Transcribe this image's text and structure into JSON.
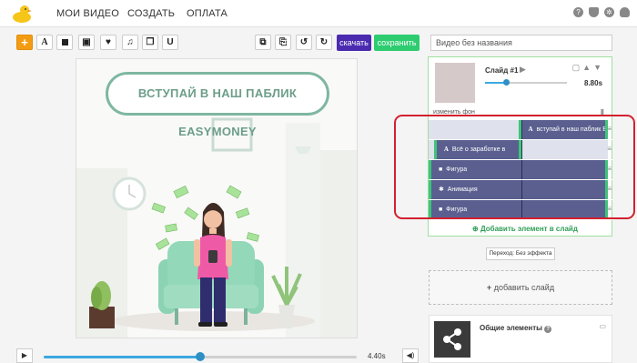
{
  "nav": {
    "items": [
      "МОИ ВИДЕО",
      "СОЗДАТЬ",
      "ОПЛАТА"
    ]
  },
  "toolbar": {
    "add_label": "+",
    "text_label": "A",
    "download_label": "скачать",
    "save_label": "сохранить",
    "title_placeholder": "Видео без названия"
  },
  "canvas": {
    "banner_text": "ВСТУПАЙ В НАШ ПАБЛИК EASYMONEY"
  },
  "player": {
    "time": "4.40s",
    "progress_fraction": 0.5
  },
  "slide": {
    "title": "Слайд #1",
    "duration": "8.80s",
    "duration_fraction": 0.25,
    "change_bg": "изменить фон",
    "layers": [
      {
        "icon": "A",
        "label": "вступай в наш паблик E",
        "start": 0.5,
        "end": 1.0
      },
      {
        "icon": "A",
        "label": "Всё о заработке в",
        "start": 0.03,
        "end": 0.52
      },
      {
        "icon": "■",
        "label": "Фигура",
        "start": 0.0,
        "end": 1.0
      },
      {
        "icon": "✱",
        "label": "Анимация",
        "start": 0.0,
        "end": 1.0
      },
      {
        "icon": "■",
        "label": "Фигура",
        "start": 0.0,
        "end": 1.0
      }
    ],
    "add_element": "Добавить элемент в слайд"
  },
  "transition": {
    "label": "Переход: Без эффекта"
  },
  "add_slide": {
    "label": "добавить слайд"
  },
  "common": {
    "title": "Общие элементы"
  },
  "colors": {
    "accent": "#4a2bb0",
    "save": "#2ecc71",
    "highlight": "#d3202f",
    "layer": "#5a5f8f"
  }
}
